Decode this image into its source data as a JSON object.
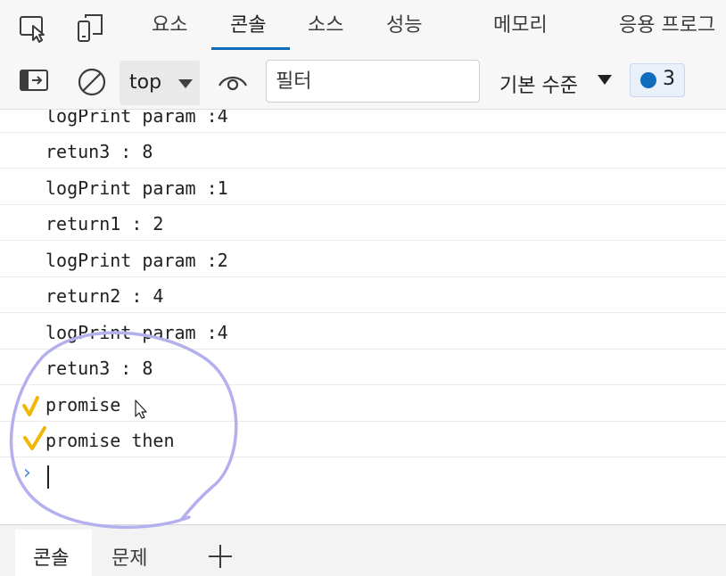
{
  "tabs": [
    {
      "label": "요소",
      "active": false
    },
    {
      "label": "콘솔",
      "active": true
    },
    {
      "label": "소스",
      "active": false
    },
    {
      "label": "성능",
      "active": false
    },
    {
      "label": "메모리",
      "active": false
    },
    {
      "label": "응용 프로그",
      "active": false
    }
  ],
  "toolbar": {
    "context": "top",
    "filter_placeholder": "필터",
    "levels": "기본 수준",
    "message_count": "3"
  },
  "console_lines": [
    "logPrint param :4",
    "retun3 : 8",
    "logPrint param :1",
    "return1 : 2",
    "logPrint param :2",
    "return2 : 4",
    "logPrint param :4",
    "retun3 : 8",
    "promise",
    "promise then"
  ],
  "drawer_tabs": [
    "콘솔",
    "문제"
  ],
  "colors": {
    "accent": "#0f6cbd",
    "annotation_circle": "#b4b0ee",
    "check_mark": "#f2b705"
  }
}
